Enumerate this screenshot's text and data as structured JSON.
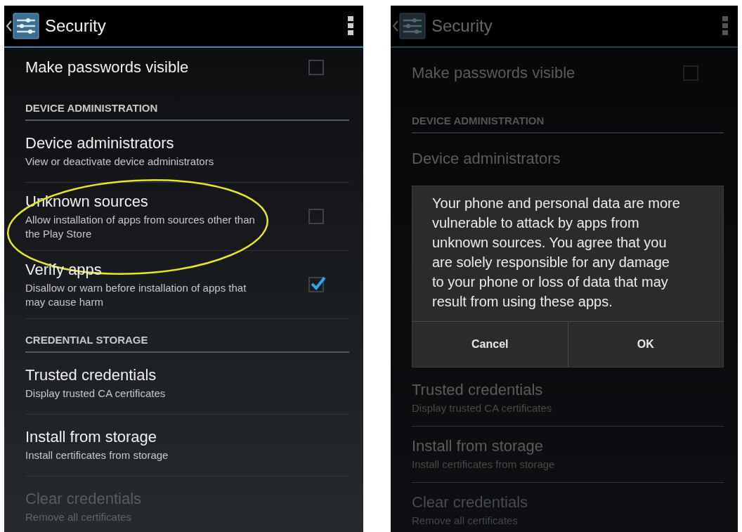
{
  "screens": [
    {
      "title": "Security",
      "dimmed": false,
      "items_above": [
        {
          "kind": "checkbox",
          "title": "Make passwords visible",
          "checked": false
        },
        {
          "kind": "header",
          "label": "DEVICE ADMINISTRATION"
        },
        {
          "kind": "link",
          "title": "Device administrators",
          "summary": "View or deactivate device administrators",
          "disabled": false
        },
        {
          "kind": "checkbox",
          "title": "Unknown sources",
          "summary": "Allow installation of apps from sources other than the Play Store",
          "checked": false,
          "highlighted": true
        },
        {
          "kind": "checkbox",
          "title": "Verify apps",
          "summary": "Disallow or warn before installation of apps that may cause harm",
          "checked": true
        },
        {
          "kind": "header",
          "label": "CREDENTIAL STORAGE"
        },
        {
          "kind": "link",
          "title": "Trusted credentials",
          "summary": "Display trusted CA certificates",
          "disabled": false
        },
        {
          "kind": "link",
          "title": "Install from storage",
          "summary": "Install certificates from storage",
          "disabled": false
        },
        {
          "kind": "link",
          "title": "Clear credentials",
          "summary": "Remove all certificates",
          "disabled": true
        }
      ]
    },
    {
      "title": "Security",
      "dimmed": true,
      "items_above": [
        {
          "kind": "checkbox",
          "title": "Make passwords visible",
          "checked": false
        },
        {
          "kind": "header",
          "label": "DEVICE ADMINISTRATION"
        },
        {
          "kind": "link",
          "title": "Device administrators",
          "disabled": false
        }
      ],
      "dialog": {
        "message": "Your phone and personal data are more vulnerable to attack by apps from unknown sources. You agree that you are solely responsible for any damage to your phone or loss of data that may result from using these apps.",
        "buttons": [
          "Cancel",
          "OK"
        ]
      },
      "items_below": [
        {
          "kind": "link",
          "title": "Trusted credentials",
          "summary": "Display trusted CA certificates",
          "disabled": false
        },
        {
          "kind": "link",
          "title": "Install from storage",
          "summary": "Install certificates from storage",
          "disabled": false
        },
        {
          "kind": "link",
          "title": "Clear credentials",
          "summary": "Remove all certificates",
          "disabled": true
        }
      ]
    }
  ]
}
